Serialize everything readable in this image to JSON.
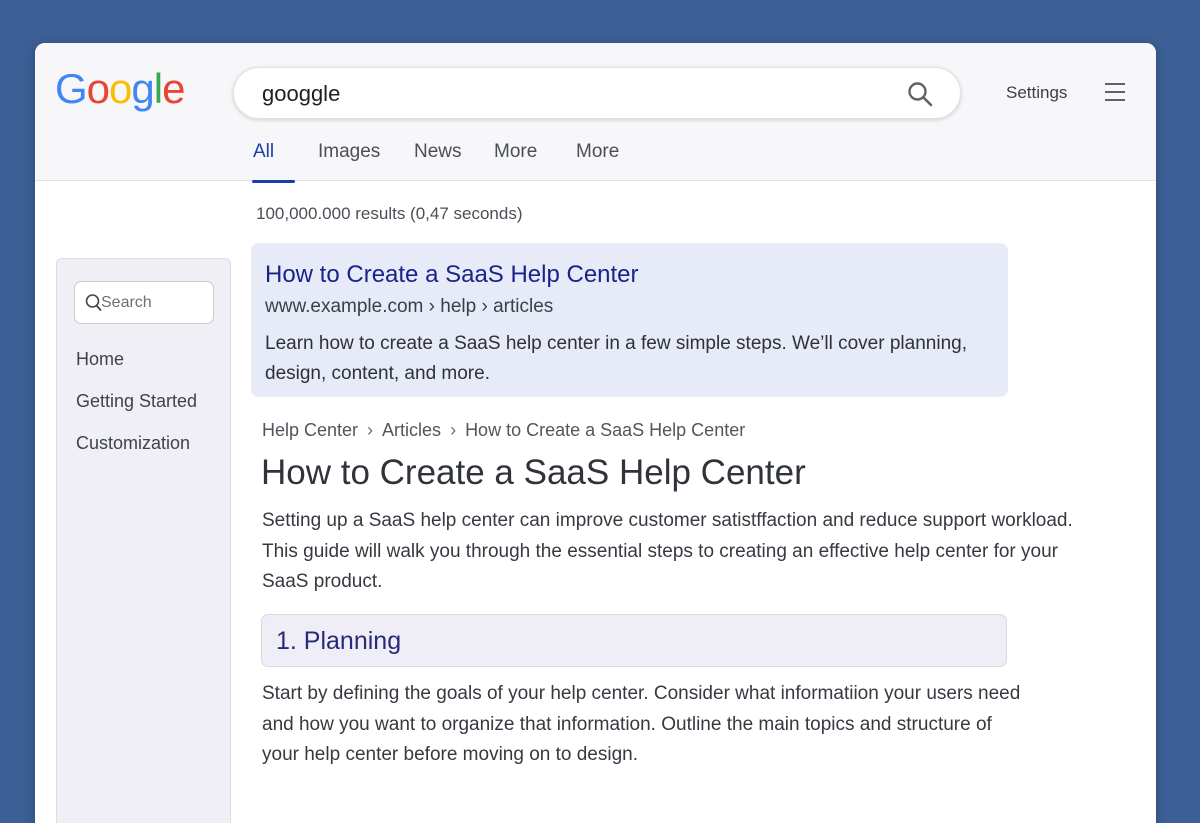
{
  "header": {
    "logo_letters": [
      "G",
      "o",
      "o",
      "g",
      "l",
      "e"
    ],
    "logo_colors": [
      "#4285F4",
      "#EA4335",
      "#FBBC05",
      "#4285F4",
      "#34A853",
      "#EA4335"
    ],
    "search_value": "googgle",
    "search_icon": "magnifier-icon",
    "settings_label": "Settings",
    "menu_icon": "hamburger-icon"
  },
  "tabs": [
    {
      "label": "All",
      "active": true
    },
    {
      "label": "Images",
      "active": false
    },
    {
      "label": "News",
      "active": false
    },
    {
      "label": "More",
      "active": false
    },
    {
      "label": "More",
      "active": false
    }
  ],
  "result_stats": "100,000.000 results (0,47 seconds)",
  "sidebar": {
    "search_placeholder": "Search",
    "items": [
      {
        "label": "Home"
      },
      {
        "label": "Getting Started"
      },
      {
        "label": "Customization"
      }
    ]
  },
  "result": {
    "title": "How to Create a SaaS Help Center",
    "url": "www.example.com › help › articles",
    "snippet": "Learn how to create a SaaS help center in a few simple steps. We’ll cover planning, design, content, and more."
  },
  "article": {
    "breadcrumb": [
      "Help Center",
      "Articles",
      "How to Create a SaaS Help Center"
    ],
    "breadcrumb_separator": "›",
    "title": "How to Create a SaaS Help Center",
    "intro": "Setting up a SaaS help center can improve customer satistffaction and reduce support workload. This guide will walk you through the essential steps to creating an effective help center for your SaaS product.",
    "section_heading": "1. Planning",
    "section_body": "Start by defining the goals of your help center. Consider what informatiion your users need and how you want to organize that information. Outline the main topics and structure of your help center before moving on to design."
  },
  "colors": {
    "page_background": "#3c5f96",
    "active_tab": "#1a3ea8",
    "result_card_bg": "#e7ebf8",
    "link_title": "#1a238a"
  }
}
